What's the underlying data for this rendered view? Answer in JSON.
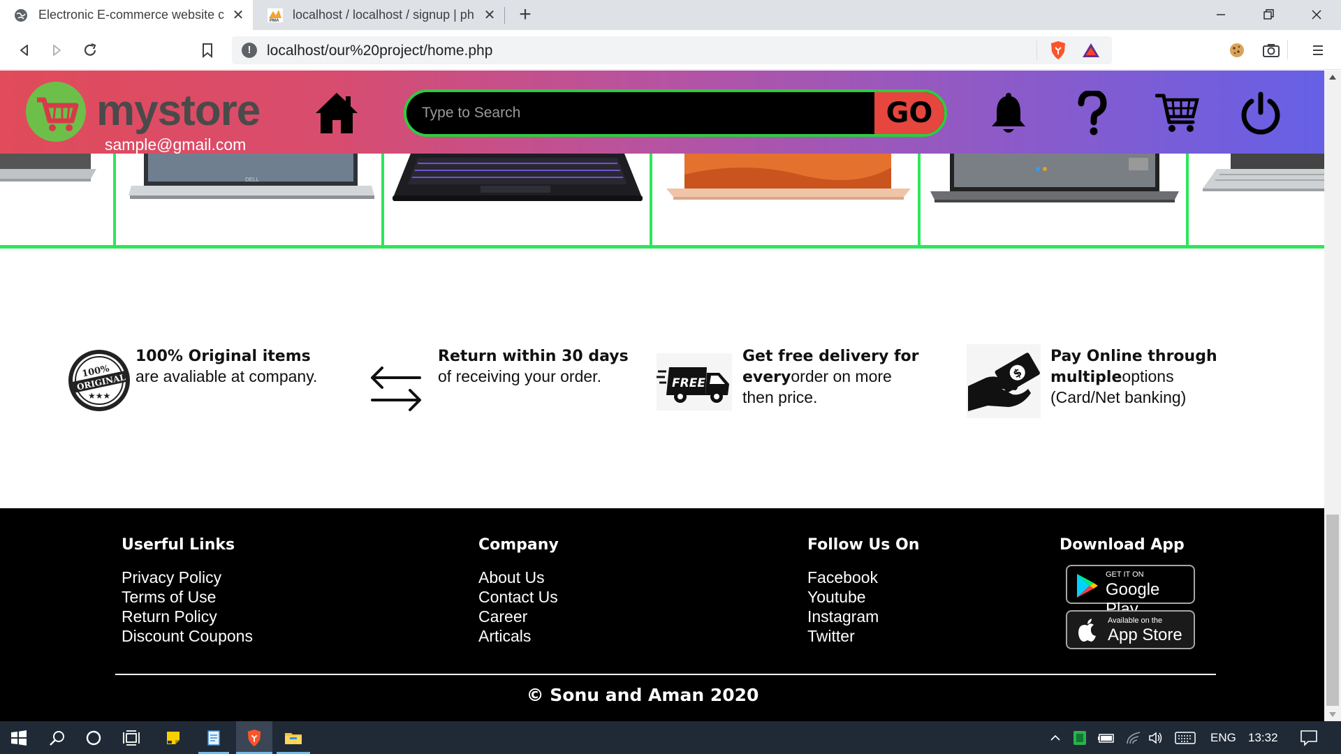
{
  "browser": {
    "tabs": [
      {
        "title": "Electronic E-commerce website cr",
        "active": true
      },
      {
        "title": "localhost / localhost / signup | php",
        "active": false
      }
    ],
    "url": "localhost/our%20project/home.php"
  },
  "header": {
    "logo_text": "mystore",
    "email": "sample@gmail.com",
    "search_placeholder": "Type to Search",
    "go_label": "GO"
  },
  "features": [
    {
      "bold": "100% Original items",
      "text": "are avaliable at company.",
      "icon": "original-seal-icon"
    },
    {
      "bold": "Return within 30 days",
      "text": "of receiving your order.",
      "icon": "return-arrows-icon"
    },
    {
      "bold": "Get free delivery for",
      "bold2": "every",
      "text": "order on more",
      "text2": "then price.",
      "icon": "free-delivery-truck-icon"
    },
    {
      "bold": "Pay Online through",
      "bold2": "multiple",
      "text": "options",
      "text2": "(Card/Net banking)",
      "icon": "pay-online-hand-icon"
    }
  ],
  "footer": {
    "useful": {
      "title": "Userful Links",
      "links": [
        "Privacy Policy",
        "Terms of Use",
        "Return Policy",
        "Discount Coupons"
      ]
    },
    "company": {
      "title": "Company",
      "links": [
        "About Us",
        "Contact Us",
        "Career",
        "Articals"
      ]
    },
    "follow": {
      "title": "Follow Us On",
      "links": [
        "Facebook",
        "Youtube",
        "Instagram",
        "Twitter"
      ]
    },
    "download": {
      "title": "Download App",
      "google_small": "GET IT ON",
      "google_big": "Google Play",
      "apple_small": "Available on the",
      "apple_big": "App Store"
    },
    "copyright": "© Sonu and Aman 2020"
  },
  "taskbar": {
    "language": "ENG",
    "time": "13:32"
  },
  "colors": {
    "accent_green": "#2ee55a",
    "go_red": "#e6463e",
    "header_gradient_start": "#e14b5a",
    "header_gradient_end": "#6660e6"
  }
}
